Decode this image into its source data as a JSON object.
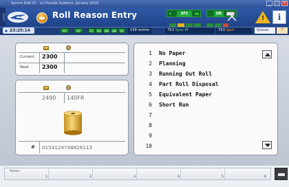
{
  "window": {
    "title": "Syncro Deb 31 - (c) Focade Systems, January 2010",
    "buttons": [
      "_",
      "□",
      "×"
    ]
  },
  "sidebar_tag": "Stand",
  "header": {
    "title": "Roll Reason Entry",
    "sf2_label": "SF2",
    "db_label": "DB"
  },
  "status": {
    "time": "23:25:14",
    "tags": [
      "P1",
      "SF",
      "F1",
      "RU",
      "DD",
      "AB",
      "F2"
    ],
    "speed": "158 m/min",
    "sync_a": "753",
    "sync_a_label": "Sync",
    "sync_a_suffix": "M",
    "sync_b": "753",
    "sync_b_label": "Spot",
    "queue_label": "Queue",
    "queue_extra": "T"
  },
  "roll_info": {
    "current_label": "Current",
    "current_value": "2300",
    "next_label": "Next",
    "next_value": "2300"
  },
  "roll_detail": {
    "number": "2490",
    "code": "140FR",
    "id_label": "#",
    "id_value": "0154124748826113"
  },
  "reasons": [
    {
      "num": "1",
      "label": "No Paper"
    },
    {
      "num": "2",
      "label": "Planning"
    },
    {
      "num": "3",
      "label": "Running Out Roll"
    },
    {
      "num": "4",
      "label": "Part Roll Disposal"
    },
    {
      "num": "5",
      "label": "Equivalent Paper"
    },
    {
      "num": "6",
      "label": "Short Run"
    },
    {
      "num": "7",
      "label": ""
    },
    {
      "num": "8",
      "label": ""
    },
    {
      "num": "9",
      "label": ""
    },
    {
      "num": "10",
      "label": ""
    }
  ],
  "softkeys": {
    "return_label": "Return",
    "numbers": [
      "1",
      "2",
      "3",
      "4",
      "5",
      "6"
    ]
  },
  "colors": {
    "header_bg": "#2f5aa8",
    "accent_green": "#1faa3a",
    "warning": "#f1b51c"
  }
}
